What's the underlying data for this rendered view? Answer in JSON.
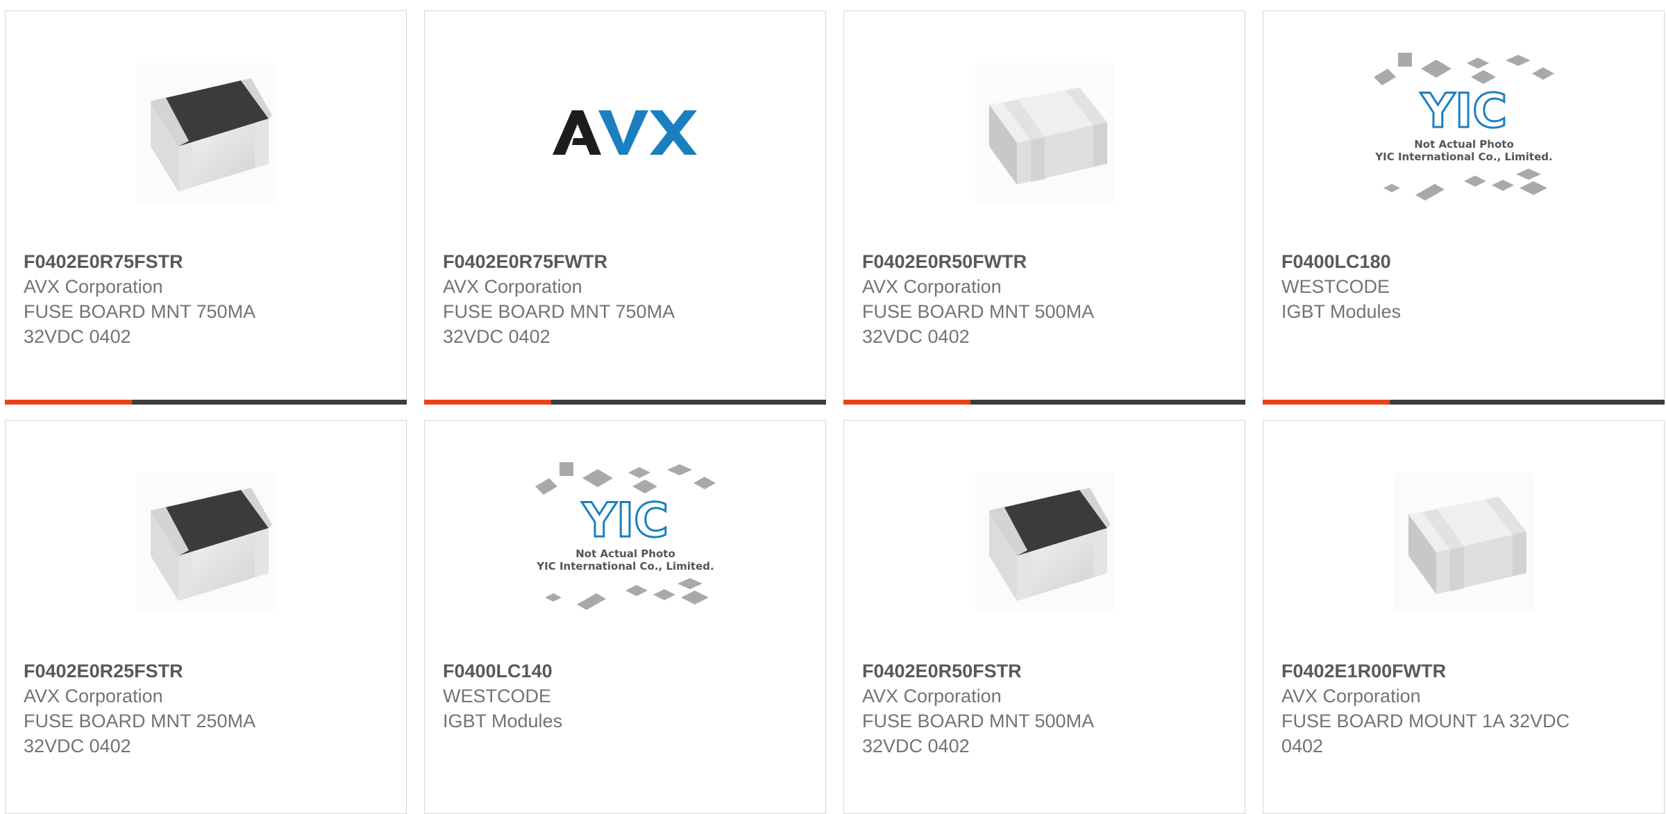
{
  "products": [
    {
      "part": "F0402E0R75FSTR",
      "manufacturer": "AVX Corporation",
      "description": "FUSE BOARD MNT 750MA 32VDC 0402",
      "image": "fuse-chip-dark-top"
    },
    {
      "part": "F0402E0R75FWTR",
      "manufacturer": "AVX Corporation",
      "description": "FUSE BOARD MNT 750MA 32VDC 0402",
      "image": "avx-logo"
    },
    {
      "part": "F0402E0R50FWTR",
      "manufacturer": "AVX Corporation",
      "description": "FUSE BOARD MNT 500MA 32VDC 0402",
      "image": "fuse-chip-white"
    },
    {
      "part": "F0400LC180",
      "manufacturer": "WESTCODE",
      "description": "IGBT Modules",
      "image": "yic-placeholder"
    },
    {
      "part": "F0402E0R25FSTR",
      "manufacturer": "AVX Corporation",
      "description": "FUSE BOARD MNT 250MA 32VDC 0402",
      "image": "fuse-chip-dark-top"
    },
    {
      "part": "F0400LC140",
      "manufacturer": "WESTCODE",
      "description": "IGBT Modules",
      "image": "yic-placeholder"
    },
    {
      "part": "F0402E0R50FSTR",
      "manufacturer": "AVX Corporation",
      "description": "FUSE BOARD MNT 500MA 32VDC 0402",
      "image": "fuse-chip-dark-top"
    },
    {
      "part": "F0402E1R00FWTR",
      "manufacturer": "AVX Corporation",
      "description": "FUSE BOARD MOUNT 1A 32VDC 0402",
      "image": "fuse-chip-white"
    }
  ],
  "avx_logo_text": "AVX",
  "yic": {
    "logo_text": "YIC",
    "line1": "Not Actual Photo",
    "line2": "YIC International Co., Limited."
  },
  "colors": {
    "accent": "#e8421a",
    "bar": "#3c3c3c",
    "part_text": "#555a5e",
    "body_text": "#6f7477"
  }
}
